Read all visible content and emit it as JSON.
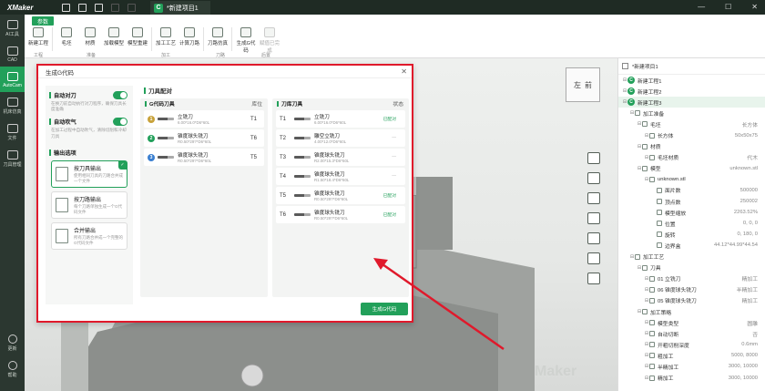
{
  "app": {
    "logo": "XMaker"
  },
  "titlebar": {
    "doc_tab": "*新建项目1",
    "doc_badge": "C",
    "win": [
      "—",
      "☐",
      "✕"
    ]
  },
  "sidebar": [
    {
      "label": "AI工具",
      "icon": "ai-tool-icon"
    },
    {
      "label": "CAD",
      "icon": "cad-icon"
    },
    {
      "label": "AutoCam",
      "icon": "cam-icon",
      "active": true
    },
    {
      "label": "机床仿真",
      "icon": "machine-sim-icon"
    },
    {
      "label": "文件",
      "icon": "file-icon"
    },
    {
      "label": "刀具管理",
      "icon": "tool-manage-icon"
    }
  ],
  "sidebar_bottom": [
    {
      "label": "更新",
      "icon": "update-icon"
    },
    {
      "label": "帮助",
      "icon": "help-icon"
    }
  ],
  "ribbon": {
    "tab": "参数",
    "buttons": [
      {
        "label": "新建工程",
        "icon": "new-project-icon"
      },
      {
        "label": "毛坯",
        "icon": "blank-icon"
      },
      {
        "label": "材质",
        "icon": "material-icon"
      },
      {
        "label": "加载模型",
        "icon": "load-model-icon"
      },
      {
        "label": "模型重建",
        "icon": "model-rebuild-icon"
      },
      {
        "label": "加工工艺",
        "icon": "process-icon"
      },
      {
        "label": "计算刀路",
        "icon": "calc-path-icon"
      },
      {
        "label": "刀路仿真",
        "icon": "path-sim-icon"
      },
      {
        "label": "生成G代码",
        "icon": "gcode-icon"
      },
      {
        "label": "赋值已完成",
        "icon": "assign-icon",
        "disabled": true
      }
    ],
    "groups": [
      "工程",
      "准备",
      "加工",
      "刀路",
      "后置"
    ]
  },
  "viewcube": {
    "left": "左",
    "front": "前"
  },
  "tree": {
    "header": "*新建项目1",
    "nodes": [
      {
        "label": "新建工程1",
        "badge": "C",
        "level": 0
      },
      {
        "label": "新建工程2",
        "badge": "C",
        "level": 0
      },
      {
        "label": "新建工程3",
        "badge": "C",
        "level": 0,
        "selected": true
      },
      {
        "label": "加工准备",
        "level": 1
      },
      {
        "label": "毛坯",
        "level": 2,
        "value": "长方体"
      },
      {
        "label": "长方体",
        "level": 3,
        "value": "50x50x75"
      },
      {
        "label": "材质",
        "level": 2
      },
      {
        "label": "毛坯材质",
        "level": 3,
        "value": "代木"
      },
      {
        "label": "模型",
        "level": 2,
        "value": "unknown.stl"
      },
      {
        "label": "unknown.stl",
        "level": 3
      },
      {
        "label": "面片数",
        "level": 4,
        "value": "500000"
      },
      {
        "label": "顶点数",
        "level": 4,
        "value": "250002"
      },
      {
        "label": "模型缩放",
        "level": 4,
        "value": "2263.52%"
      },
      {
        "label": "位置",
        "level": 4,
        "value": "0, 0, 0"
      },
      {
        "label": "旋转",
        "level": 4,
        "value": "0, 180, 0"
      },
      {
        "label": "边界盒",
        "level": 4,
        "value": "44.12*44.99*44.54"
      },
      {
        "label": "加工工艺",
        "level": 1
      },
      {
        "label": "刀具",
        "level": 2
      },
      {
        "label": "01 立铣刀",
        "level": 3,
        "value": "精加工"
      },
      {
        "label": "06 锥度球头铣刀",
        "level": 3,
        "value": "半精加工"
      },
      {
        "label": "05 锥度球头铣刀",
        "level": 3,
        "value": "精加工"
      },
      {
        "label": "加工策略",
        "level": 2
      },
      {
        "label": "模型类型",
        "level": 3,
        "value": "圆雕"
      },
      {
        "label": "自动切断",
        "level": 3,
        "value": "否"
      },
      {
        "label": "开粗切削深度",
        "level": 3,
        "value": "0.6mm"
      },
      {
        "label": "粗加工",
        "level": 3,
        "value": "5000, 8000"
      },
      {
        "label": "半精加工",
        "level": 3,
        "value": "3000, 10000"
      },
      {
        "label": "精加工",
        "level": 3,
        "value": "3000, 10000"
      }
    ]
  },
  "dialog": {
    "title": "生成G代码",
    "left": {
      "auto_tool": {
        "label": "自动对刀",
        "desc": "在换刀前自动执行对刀程序，确保刀具长度准确"
      },
      "auto_blow": {
        "label": "自动吹气",
        "desc": "在加工过程中自动吹气，清除切削和冷却刀具"
      },
      "output_title": "输出选项",
      "options": [
        {
          "title": "按刀具输出",
          "desc": "使用相同刀具的刀路合并成一个文件",
          "active": true
        },
        {
          "title": "按刀路输出",
          "desc": "每个刀路单独生成一个G代码文件"
        },
        {
          "title": "合并输出",
          "desc": "所有刀路合并成一个完整的G代码文件"
        }
      ]
    },
    "mid_title": "刀具配对",
    "gcode_panel": {
      "title": "G代码刀具",
      "col": "库位",
      "rows": [
        {
          "num": "1",
          "name": "立铣刀",
          "spec": "6.00*16.0*D6*60L",
          "pos": "T1",
          "color": "#c8a23a"
        },
        {
          "num": "2",
          "name": "锥度球头铣刀",
          "spec": "R0.50*29?*D6*60L",
          "pos": "T6",
          "color": "#22a05a"
        },
        {
          "num": "3",
          "name": "锥度球头铣刀",
          "spec": "R0.50*29?*D6*60L",
          "pos": "T5",
          "color": "#3a7fd0"
        }
      ]
    },
    "lib_panel": {
      "title": "刀库刀具",
      "col": "状态",
      "rows": [
        {
          "id": "T1",
          "name": "立铣刀",
          "spec": "6.00*16.0*D6*60L",
          "status": "已配对"
        },
        {
          "id": "T2",
          "name": "雕空立铣刀",
          "spec": "4.00*12.0*D6*60L",
          "status": "—"
        },
        {
          "id": "T3",
          "name": "锥度球头铣刀",
          "spec": "R2.00*15.3*D6*60L",
          "status": "—"
        },
        {
          "id": "T4",
          "name": "锥度球头铣刀",
          "spec": "R1.50*18.4*D6*60L",
          "status": "—"
        },
        {
          "id": "T5",
          "name": "锥度球头铣刀",
          "spec": "R0.50*29?*D6*60L",
          "status": "已配对"
        },
        {
          "id": "T6",
          "name": "锥度球头铣刀",
          "spec": "R0.50*29?*D6*60L",
          "status": "已配对"
        }
      ]
    },
    "generate_btn": "生成G代码",
    "close": "✕"
  },
  "watermark": "Maker"
}
